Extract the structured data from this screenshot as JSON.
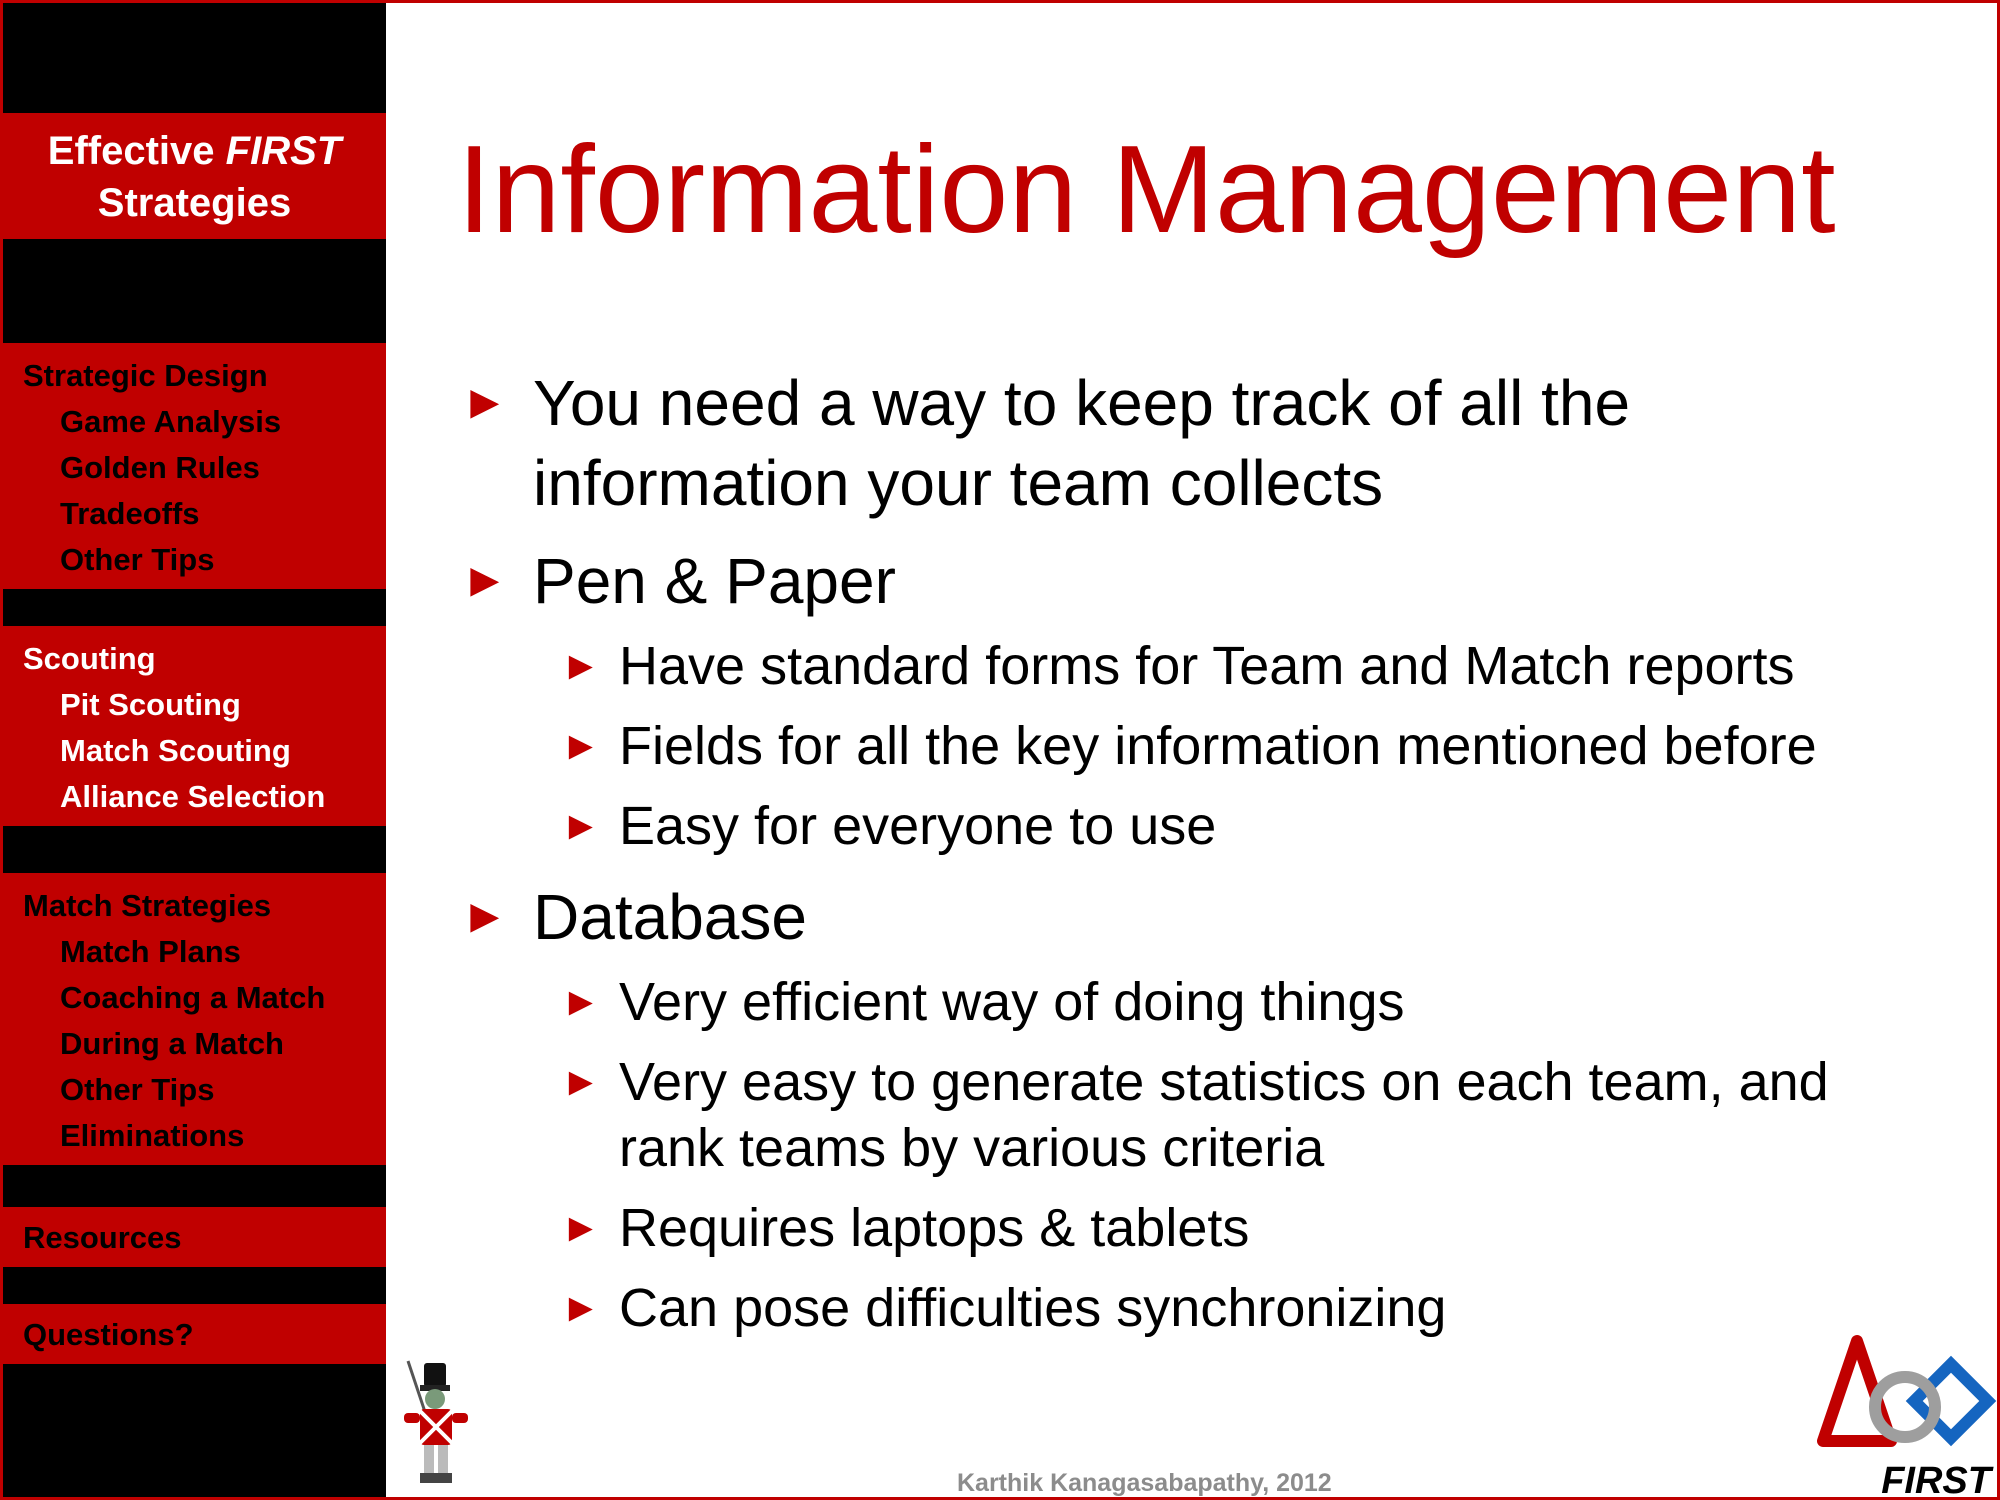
{
  "brand": {
    "line1_prefix": "Effective ",
    "line1_emph": "FIRST",
    "line2": "Strategies"
  },
  "sidebar": {
    "sections": [
      {
        "head": "Strategic Design",
        "items": [
          "Game Analysis",
          "Golden Rules",
          "Tradeoffs",
          "Other Tips"
        ]
      },
      {
        "head": "Scouting",
        "items": [
          "Pit Scouting",
          "Match Scouting",
          "Alliance Selection"
        ]
      },
      {
        "head": "Match Strategies",
        "items": [
          "Match Plans",
          "Coaching a Match",
          "During a Match",
          "Other Tips",
          "Eliminations"
        ]
      },
      {
        "head": "Resources"
      },
      {
        "head": "Questions?"
      }
    ]
  },
  "slide": {
    "title": "Information Management",
    "bullets": [
      {
        "text": "You need a way to keep track of all the information your team collects"
      },
      {
        "text": "Pen & Paper",
        "sub": [
          "Have standard forms for Team and Match reports",
          "Fields for all the key information mentioned before",
          "Easy for everyone to use"
        ]
      },
      {
        "text": "Database",
        "sub": [
          "Very efficient way of doing things",
          "Very easy to generate statistics on each team, and rank teams by various criteria",
          "Requires laptops & tablets",
          "Can pose difficulties synchronizing"
        ]
      }
    ],
    "arrow_glyph": "►"
  },
  "footer": {
    "credit": "Karthik Kanagasabapathy, 2012"
  },
  "logo": {
    "text": "FIRST"
  },
  "colors": {
    "accent": "#c00000",
    "sidebar_bg": "#000000",
    "footer_text": "#8c8c8c"
  }
}
